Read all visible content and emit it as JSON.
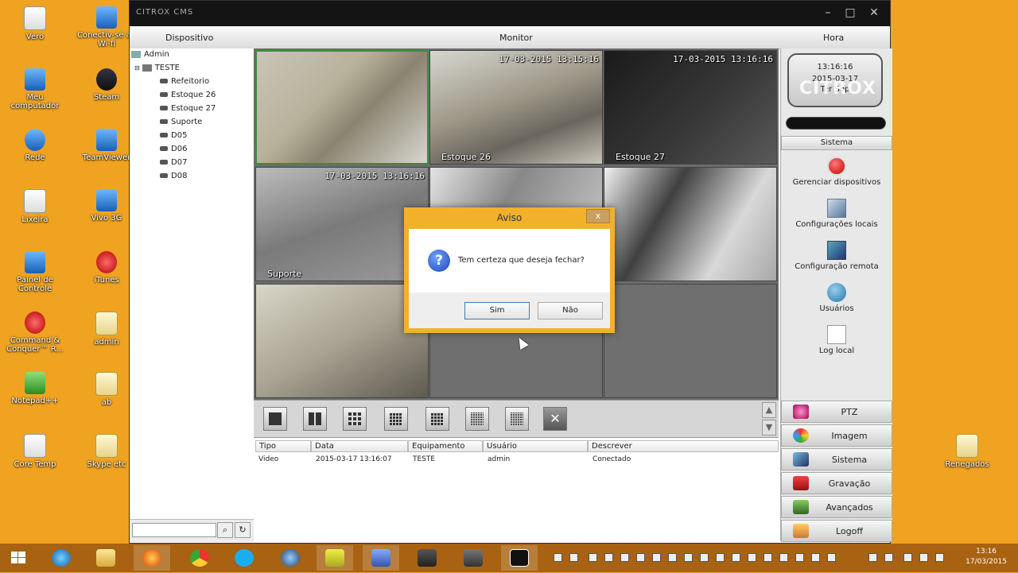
{
  "desktop": {
    "icons_left": [
      {
        "label": "Vero",
        "icon": "user-folder-icon"
      },
      {
        "label": "Conectiv-se ao Wi-fi",
        "icon": "wifi-icon"
      },
      {
        "label": "Meu computador",
        "icon": "computer-icon"
      },
      {
        "label": "Steam",
        "icon": "steam-icon"
      },
      {
        "label": "Rede",
        "icon": "network-icon"
      },
      {
        "label": "TeamViewer",
        "icon": "teamviewer-icon"
      },
      {
        "label": "Lixeira",
        "icon": "recycle-bin-icon"
      },
      {
        "label": "Vivo 3G",
        "icon": "vivo-icon"
      },
      {
        "label": "Painel de Controle",
        "icon": "control-panel-icon"
      },
      {
        "label": "iTunes",
        "icon": "itunes-icon"
      },
      {
        "label": "Command & Conquer™ R...",
        "icon": "game-icon"
      },
      {
        "label": "admin",
        "icon": "file-icon"
      },
      {
        "label": "Notepad++",
        "icon": "notepad-icon"
      },
      {
        "label": "ab",
        "icon": "file-icon"
      },
      {
        "label": "Core Temp",
        "icon": "thermometer-icon"
      },
      {
        "label": "Skype etc",
        "icon": "file-icon"
      }
    ],
    "icon_right": {
      "label": "Renegados",
      "icon": "file-icon"
    }
  },
  "window": {
    "title": "CITROX CMS",
    "menu": {
      "dispositivo": "Dispositivo",
      "monitor": "Monitor",
      "hora": "Hora"
    }
  },
  "tree": {
    "root": "Admin",
    "group": "TESTE",
    "items": [
      "Refeitorio",
      "Estoque 26",
      "Estoque 27",
      "Suporte",
      "D05",
      "D06",
      "D07",
      "D08"
    ]
  },
  "cameras": [
    {
      "timestamp": "",
      "label": ""
    },
    {
      "timestamp": "17-03-2015 13:15:16",
      "label": "Estoque 26"
    },
    {
      "timestamp": "17-03-2015 13:16:16",
      "label": "Estoque 27"
    },
    {
      "timestamp": "17-03-2015 13:16:16",
      "label": "Suporte"
    },
    {
      "timestamp": "",
      "label": ""
    },
    {
      "timestamp": "",
      "label": ""
    },
    {
      "timestamp": "",
      "label": ""
    }
  ],
  "log": {
    "headers": [
      "Tipo",
      "Data",
      "Equipamento",
      "Usuário",
      "Descrever"
    ],
    "rows": [
      {
        "tipo": "Video",
        "data": "2015-03-17 13:16:07",
        "equipamento": "TESTE",
        "usuario": "admin",
        "descrever": "Conectado"
      }
    ]
  },
  "right_panel": {
    "clock_time": "13:16:16",
    "clock_date": "2015-03-17",
    "clock_day": "Ter Sep",
    "watermark": "CITROX",
    "sistema_header": "Sistema",
    "system_items": [
      {
        "label": "Gerenciar dispositivos",
        "icon": "record-button-icon"
      },
      {
        "label": "Configurações locais",
        "icon": "local-config-icon"
      },
      {
        "label": "Configuração remota",
        "icon": "remote-config-icon"
      },
      {
        "label": "Usuários",
        "icon": "users-icon"
      },
      {
        "label": "Log local",
        "icon": "document-icon"
      }
    ],
    "nav": [
      {
        "label": "PTZ",
        "icon": "ptz-icon"
      },
      {
        "label": "Imagem",
        "icon": "image-icon"
      },
      {
        "label": "Sistema",
        "icon": "system-icon"
      },
      {
        "label": "Gravação",
        "icon": "recording-icon"
      },
      {
        "label": "Avançados",
        "icon": "advanced-icon"
      },
      {
        "label": "Logoff",
        "icon": "logoff-icon"
      }
    ]
  },
  "dialog": {
    "title": "Aviso",
    "message": "Tem certeza que deseja fechar?",
    "yes": "Sim",
    "no": "Não",
    "close": "x"
  },
  "taskbar": {
    "clock_time": "13:16",
    "clock_date": "17/03/2015"
  }
}
